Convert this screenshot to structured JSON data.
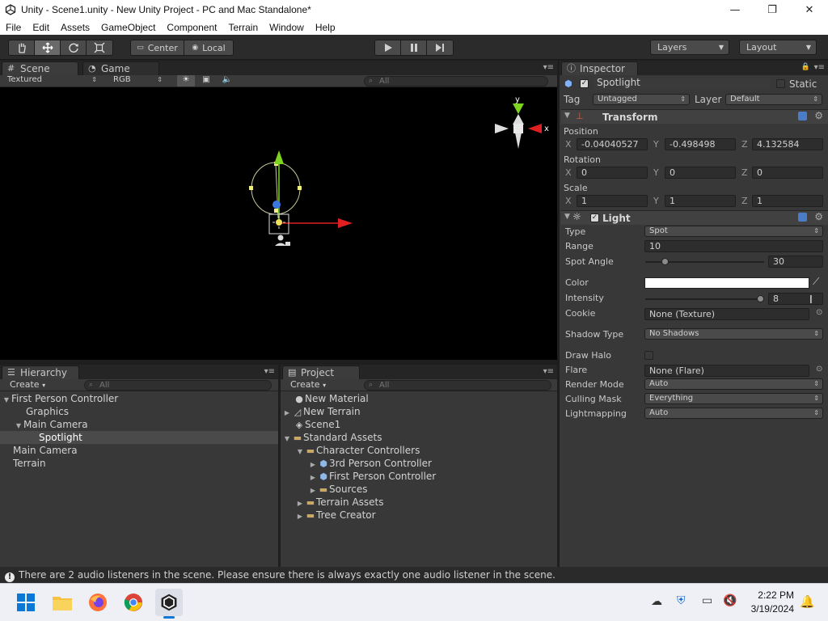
{
  "window": {
    "title": "Unity - Scene1.unity - New Unity Project - PC and Mac Standalone*",
    "minimize": "—",
    "maximize": "❐",
    "close": "✕"
  },
  "menu": [
    "File",
    "Edit",
    "Assets",
    "GameObject",
    "Component",
    "Terrain",
    "Window",
    "Help"
  ],
  "toolbar": {
    "pivot_center": "Center",
    "pivot_local": "Local",
    "layers": "Layers",
    "layout": "Layout"
  },
  "scene_panel": {
    "tab_scene": "Scene",
    "tab_game": "Game",
    "render_mode": "Textured",
    "color_mode": "RGB",
    "search_placeholder": "All",
    "gizmo_y": "y",
    "gizmo_x": "x"
  },
  "hierarchy": {
    "tab": "Hierarchy",
    "create": "Create",
    "search_placeholder": "All",
    "items": [
      {
        "label": "First Person Controller",
        "depth": 0,
        "expanded": true
      },
      {
        "label": "Graphics",
        "depth": 1
      },
      {
        "label": "Main Camera",
        "depth": 1,
        "expanded": true
      },
      {
        "label": "Spotlight",
        "depth": 2,
        "selected": true
      },
      {
        "label": "Main Camera",
        "depth": 0
      },
      {
        "label": "Terrain",
        "depth": 0
      }
    ]
  },
  "project": {
    "tab": "Project",
    "create": "Create",
    "search_placeholder": "All",
    "items": [
      {
        "label": "New Material",
        "icon": "material-icon"
      },
      {
        "label": "New Terrain",
        "icon": "terrain-icon"
      },
      {
        "label": "Scene1",
        "icon": "unity-scene-icon"
      },
      {
        "label": "Standard Assets",
        "icon": "folder-icon",
        "expanded": true
      },
      {
        "label": "Character Controllers",
        "icon": "folder-icon",
        "expanded": true
      },
      {
        "label": "3rd Person Controller",
        "icon": "prefab-icon"
      },
      {
        "label": "First Person Controller",
        "icon": "prefab-icon"
      },
      {
        "label": "Sources",
        "icon": "folder-icon"
      },
      {
        "label": "Terrain Assets",
        "icon": "folder-icon"
      },
      {
        "label": "Tree Creator",
        "icon": "folder-icon"
      }
    ]
  },
  "inspector": {
    "tab": "Inspector",
    "object_name": "Spotlight",
    "static_label": "Static",
    "tag_label": "Tag",
    "tag_value": "Untagged",
    "layer_label": "Layer",
    "layer_value": "Default",
    "transform": {
      "title": "Transform",
      "position_label": "Position",
      "rotation_label": "Rotation",
      "scale_label": "Scale",
      "x": "X",
      "y": "Y",
      "z": "Z",
      "position": [
        "-0.04040527",
        "-0.498498",
        "4.132584"
      ],
      "rotation": [
        "0",
        "0",
        "0"
      ],
      "scale": [
        "1",
        "1",
        "1"
      ]
    },
    "light": {
      "title": "Light",
      "type_label": "Type",
      "type_value": "Spot",
      "range_label": "Range",
      "range_value": "10",
      "spot_angle_label": "Spot Angle",
      "spot_angle_value": "30",
      "color_label": "Color",
      "color_value": "#ffffff",
      "intensity_label": "Intensity",
      "intensity_value": "8",
      "cookie_label": "Cookie",
      "cookie_value": "None (Texture)",
      "shadow_type_label": "Shadow Type",
      "shadow_type_value": "No Shadows",
      "draw_halo_label": "Draw Halo",
      "flare_label": "Flare",
      "flare_value": "None (Flare)",
      "render_mode_label": "Render Mode",
      "render_mode_value": "Auto",
      "culling_mask_label": "Culling Mask",
      "culling_mask_value": "Everything",
      "lightmapping_label": "Lightmapping",
      "lightmapping_value": "Auto"
    }
  },
  "status": {
    "message": "There are 2 audio listeners in the scene. Please ensure there is always exactly one audio listener in the scene."
  },
  "taskbar": {
    "time": "2:22 PM",
    "date": "3/19/2024"
  },
  "colors": {
    "accent_selection": "#4a4a4a",
    "axis_x": "#e02020",
    "axis_y": "#7ed321",
    "axis_z": "#3a78e0"
  }
}
